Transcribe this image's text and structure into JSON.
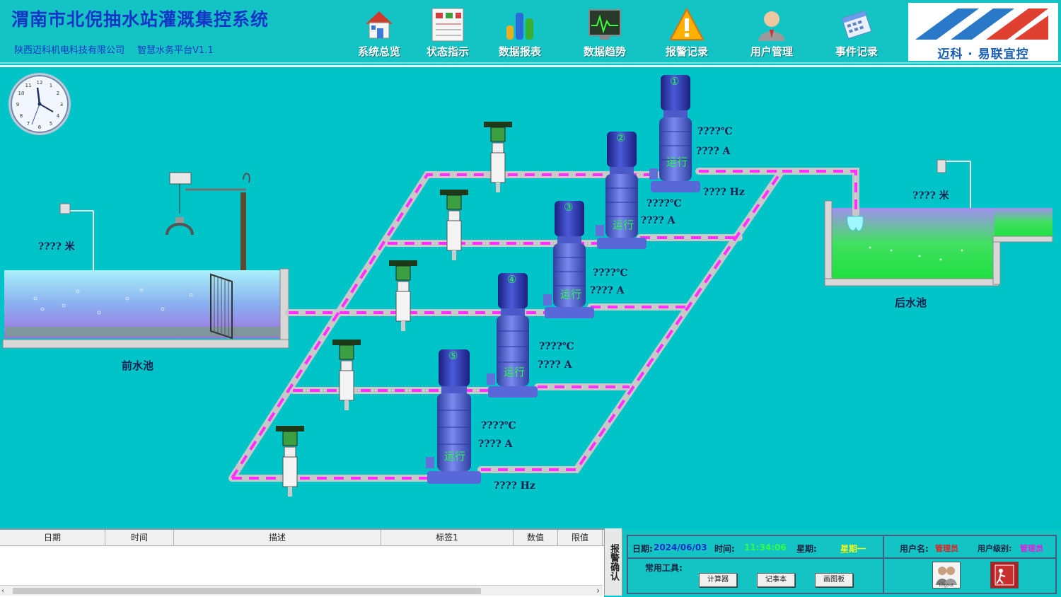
{
  "header": {
    "title": "渭南市北倪抽水站灌溉集控系统",
    "company": "陕西迈科机电科技有限公司",
    "platform": "智慧水务平台V1.1",
    "logo_text": "迈科 · 易联宜控"
  },
  "nav": [
    {
      "label": "系统总览",
      "icon": "home-icon"
    },
    {
      "label": "状态指示",
      "icon": "status-panel-icon"
    },
    {
      "label": "数据报表",
      "icon": "bar-chart-icon"
    },
    {
      "label": "数据趋势",
      "icon": "trend-monitor-icon"
    },
    {
      "label": "报警记录",
      "icon": "warning-icon"
    },
    {
      "label": "用户管理",
      "icon": "user-icon"
    },
    {
      "label": "事件记录",
      "icon": "calendar-icon"
    }
  ],
  "scada": {
    "front_pool": {
      "label": "前水池",
      "level": "???? 米"
    },
    "rear_pool": {
      "label": "后水池",
      "level": "???? 米"
    },
    "pumps": [
      {
        "num": "①",
        "temp": "????℃",
        "current": "???? A",
        "freq": "???? Hz",
        "state": "运行"
      },
      {
        "num": "②",
        "temp": "????℃",
        "current": "???? A",
        "state": "运行"
      },
      {
        "num": "③",
        "temp": "????℃",
        "current": "???? A",
        "state": "运行"
      },
      {
        "num": "④",
        "temp": "????℃",
        "current": "???? A",
        "state": "运行"
      },
      {
        "num": "⑤",
        "temp": "????℃",
        "current": "???? A",
        "freq": "???? Hz",
        "state": "运行"
      }
    ]
  },
  "alarm_table": {
    "columns": [
      "日期",
      "时间",
      "描述",
      "标签1",
      "数值",
      "限值"
    ],
    "ack_label": "报警确认"
  },
  "status_bar": {
    "date_label": "日期:",
    "date_value": "2024/06/03",
    "time_label": "时间:",
    "time_value": "11:34:06",
    "week_label": "星期:",
    "week_value": "星期一",
    "user_label": "用户名:",
    "user_value": "管理员",
    "level_label": "用户级别:",
    "level_value": "管理员",
    "tools_label": "常用工具:",
    "tools": [
      "计算器",
      "记事本",
      "画图板"
    ],
    "logout_label": "Logout"
  },
  "colors": {
    "background": "#00c4c8",
    "title": "#1436c8",
    "flow": "#ff30ff",
    "pump": "#5060d0"
  }
}
